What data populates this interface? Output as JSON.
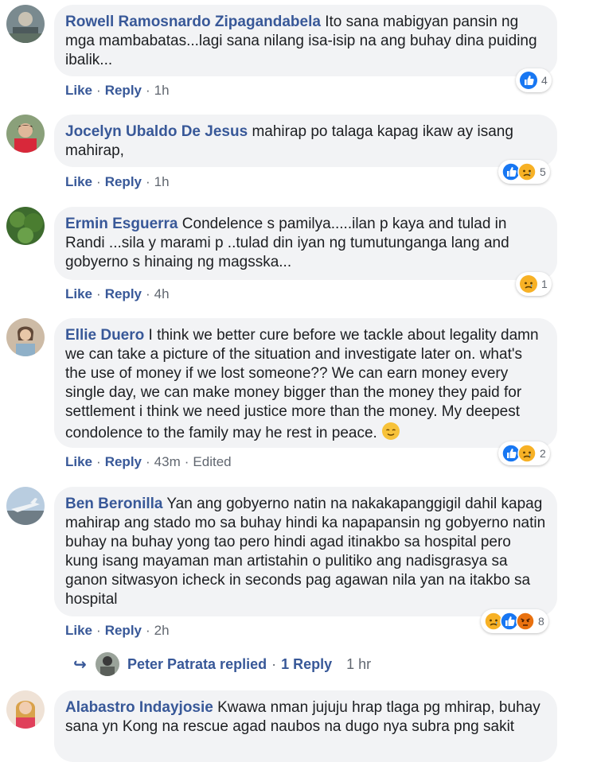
{
  "comments": [
    {
      "name": "Rowell Ramosnardo Zipagandabela",
      "text": "Ito sana mabigyan pansin ng mga mambabatas...lagi sana nilang isa-isip na ang buhay dina puiding ibalik...",
      "like": "Like",
      "reply": "Reply",
      "time": "1h",
      "reactions": [
        "like-icon"
      ],
      "reaction_count": "4"
    },
    {
      "name": "Jocelyn Ubaldo De Jesus",
      "text": "mahirap po talaga kapag ikaw ay isang mahirap,",
      "like": "Like",
      "reply": "Reply",
      "time": "1h",
      "reactions": [
        "like-icon",
        "sad-icon"
      ],
      "reaction_count": "5"
    },
    {
      "name": "Ermin Esguerra",
      "text": "Condelence s pamilya.....ilan p kaya and tulad in Randi ...sila y marami p ..tulad din iyan ng tumutunganga lang and gobyerno s hinaing ng magsska...",
      "like": "Like",
      "reply": "Reply",
      "time": "4h",
      "reactions": [
        "sad-icon"
      ],
      "reaction_count": "1"
    },
    {
      "name": "Ellie Duero",
      "text": "I think we better cure before we tackle about legality damn we can take a picture of the situation and investigate later on. what's the use of money if we lost someone?? We can earn money every single day, we can make money bigger than the money they paid for settlement i think we need justice more than the money. My deepest condolence to the family may he rest in peace.",
      "like": "Like",
      "reply": "Reply",
      "time": "43m",
      "edited": "Edited",
      "reactions": [
        "like-icon",
        "sad-icon"
      ],
      "reaction_count": "2"
    },
    {
      "name": "Ben Beronilla",
      "text": "Yan ang gobyerno natin na nakakapanggigil dahil kapag mahirap ang stado mo sa buhay hindi ka napapansin ng gobyerno natin buhay na buhay yong tao pero hindi agad itinakbo sa hospital pero kung isang mayaman man artistahin o pulitiko ang nadisgrasya sa ganon sitwasyon icheck in seconds pag agawan nila yan na itakbo sa hospital",
      "like": "Like",
      "reply": "Reply",
      "time": "2h",
      "reactions": [
        "sad-icon",
        "like-icon",
        "angry-icon"
      ],
      "reaction_count": "8"
    },
    {
      "name": "Alabastro Indayjosie",
      "text": "Kwawa nman jujuju hrap tlaga pg mhirap, buhay sana yn Kong na rescue agad naubos na dugo nya subra png sakit"
    }
  ],
  "replies_row": {
    "who": "Peter Patrata replied",
    "count": "1 Reply",
    "time": "1 hr"
  },
  "colors": {
    "link": "#385898",
    "bubble": "#f2f3f5",
    "like": "#1877f2",
    "sad": "#f7b125",
    "angry": "#e9710f"
  }
}
